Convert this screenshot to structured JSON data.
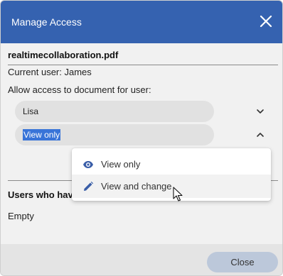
{
  "dialog": {
    "title": "Manage Access",
    "close_icon": "close-icon",
    "filename": "realtimecollaboration.pdf",
    "current_user": "Current user: James",
    "allow_label": "Allow access to document for user:",
    "user_select": {
      "value": "Lisa",
      "icon": "chevron-down-icon"
    },
    "permission_select": {
      "value": "View only",
      "icon": "chevron-up-icon"
    },
    "users_heading": "Users who hav",
    "empty_text": "Empty",
    "close_button": "Close"
  },
  "dropdown": {
    "items": [
      {
        "label": "View only",
        "icon": "eye-icon"
      },
      {
        "label": "View and change",
        "icon": "pencil-icon"
      }
    ]
  },
  "colors": {
    "header": "#3562b0",
    "icon_blue": "#3a5ea8",
    "selection": "#3874d8",
    "close_button_bg": "#bcc8da"
  }
}
